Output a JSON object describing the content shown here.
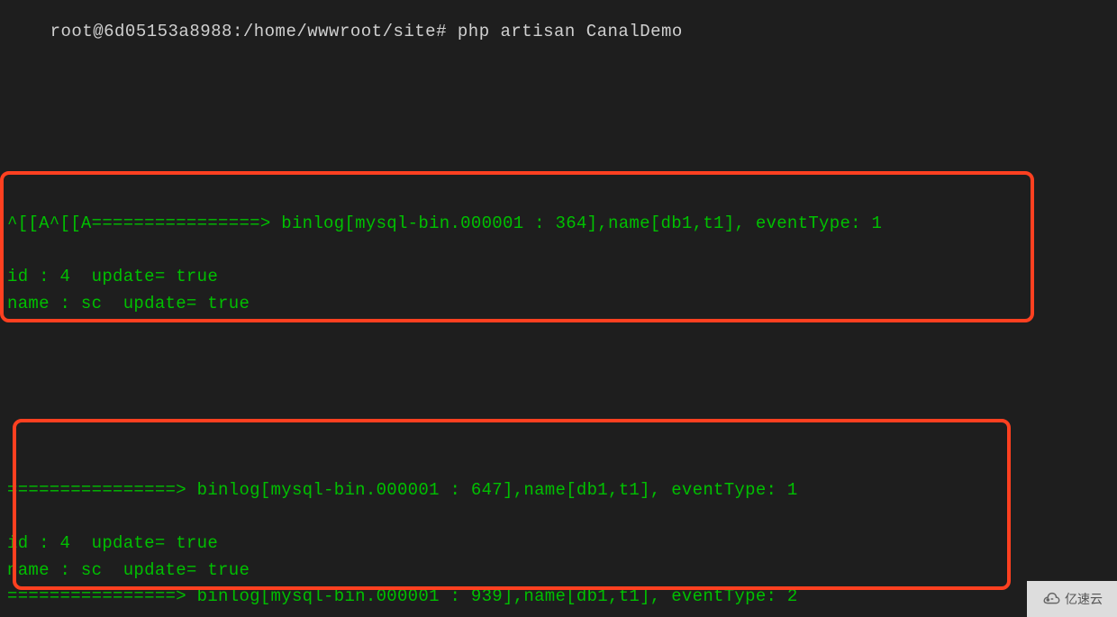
{
  "terminal": {
    "prompt": "root@6d05153a8988:/home/wwwroot/site# ",
    "command": "php artisan CanalDemo",
    "block1": {
      "line1": "^[[A^[[A================> binlog[mysql-bin.000001 : 364],name[db1,t1], eventType: 1",
      "line2": "id : 4  update= true",
      "line3": "name : sc  update= true"
    },
    "block2": {
      "line1": "================> binlog[mysql-bin.000001 : 647],name[db1,t1], eventType: 1",
      "line2": "id : 4  update= true",
      "line3": "name : sc  update= true"
    },
    "line3": "================> binlog[mysql-bin.000001 : 939],name[db1,t1], eventType: 2"
  },
  "watermark": {
    "text": "亿速云"
  }
}
